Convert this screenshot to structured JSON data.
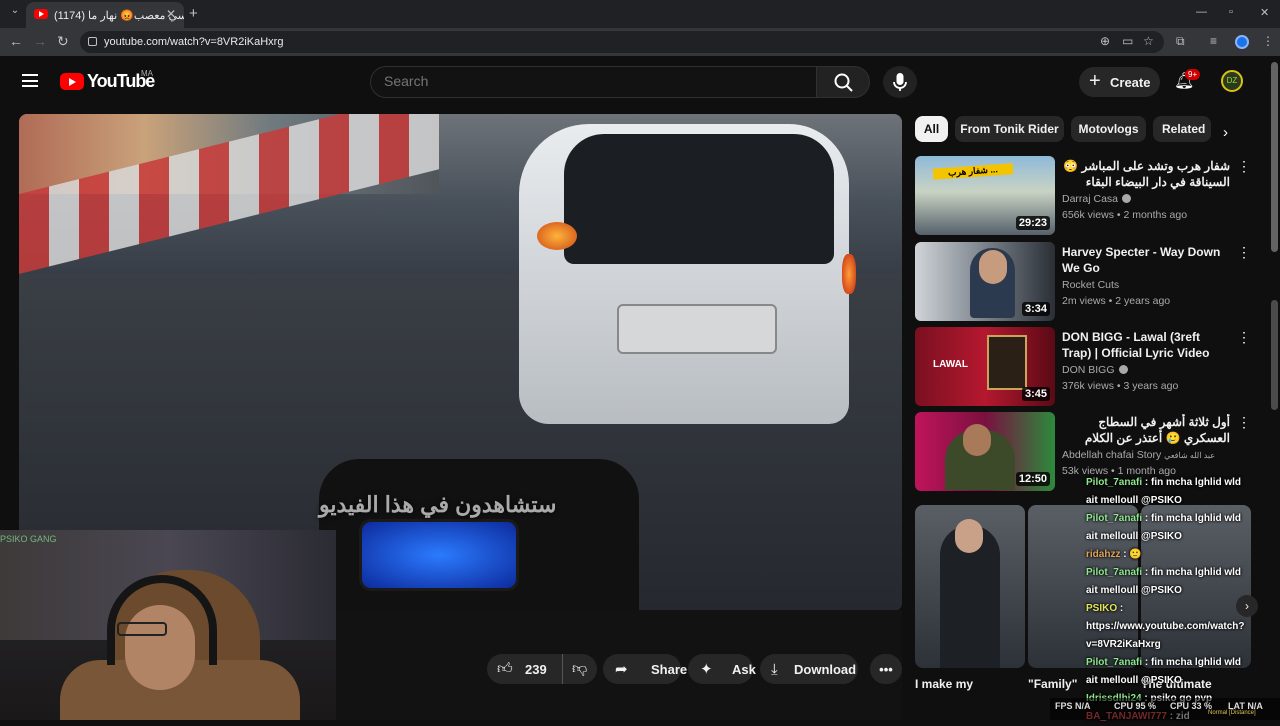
{
  "browser": {
    "tab_title": "(1174) بوليسي معصب😡 نهار ما",
    "url": "youtube.com/watch?v=8VR2iKaHxrg"
  },
  "header": {
    "logo_text": "YouTube",
    "country": "MA",
    "search_placeholder": "Search",
    "create_label": "Create",
    "notif_badge": "9+",
    "avatar_text": "DZ"
  },
  "video": {
    "subtitle": "ستشاهدون في هذا الفيديو"
  },
  "actions": {
    "like_count": "239",
    "share_label": "Share",
    "ask_label": "Ask",
    "download_label": "Download"
  },
  "chips": [
    "All",
    "From Tonik Rider",
    "Motovlogs",
    "Related"
  ],
  "recommendations": [
    {
      "title": "شفار هرب وتشد على المباشر 😳 السيناقة في دار البيضاء البقاء للأقوى 😂 أفضل لقطات",
      "channel": "Darraj Casa",
      "verified": true,
      "meta": "656k views • 2 months ago",
      "duration": "29:23",
      "rtl": true,
      "thumb_text": "شفار هرب ..."
    },
    {
      "title": "Harvey Specter - Way Down We Go",
      "channel": "Rocket Cuts",
      "verified": false,
      "meta": "2m views • 2 years ago",
      "duration": "3:34",
      "rtl": false,
      "thumb_text": ""
    },
    {
      "title": "DON BIGG - Lawal (3reft Trap) | Official Lyric Video (Clean ...",
      "channel": "DON BIGG",
      "verified": true,
      "meta": "376k views • 3 years ago",
      "duration": "3:45",
      "rtl": false,
      "thumb_text": "LAWAL"
    },
    {
      "title": "أول ثلاثة أشهر في السطاج العسكري 🥲 أعتذر عن الكلام الذاتي 🥲",
      "channel": "Abdellah chafai Story",
      "channel_extra": "عبد الله شافعي",
      "verified": false,
      "meta": "53k views • 1 month ago",
      "duration": "12:50",
      "rtl": true,
      "thumb_text": ""
    }
  ],
  "shorts": [
    {
      "title": "I make my"
    },
    {
      "title": "\"Family\""
    },
    {
      "title": "The ultimate"
    }
  ],
  "chat": [
    {
      "name": "Pilot_7anafi",
      "text": "fin mcha lghlid wld ait melloull @PSIKO"
    },
    {
      "name": "Pilot_7anafi",
      "text": "fin mcha lghlid wld ait melloull @PSIKO"
    },
    {
      "name": "ridahzz",
      "text": "🙂"
    },
    {
      "name": "Pilot_7anafi",
      "text": "fin mcha lghlid wld ait melloull @PSIKO"
    },
    {
      "name": "PSIKO",
      "text": "https://www.youtube.com/watch?v=8VR2iKaHxrg"
    },
    {
      "name": "Pilot_7anafi",
      "text": "fin mcha lghlid wld ait melloull @PSIKO"
    },
    {
      "name": "Idrissdlhi24",
      "text": "psiko go pvp"
    },
    {
      "name": "BA_TANJAWI777",
      "text": "zid"
    }
  ],
  "chat_top_partial": "Pilot_7anafi : fin mcha lghlid wld ait melloull @PSIKO",
  "overlay": {
    "fps": "FPS N/A",
    "cpu1": "CPU 95 %",
    "cpu2": "CPU 33 %",
    "lat": "LAT N/A",
    "mode": "Normal [Distance]"
  },
  "webcam": {
    "sign_text": "PSIKO GANG"
  },
  "colors": {
    "accent_red": "#ff0000",
    "bg": "#0f0f0f"
  }
}
